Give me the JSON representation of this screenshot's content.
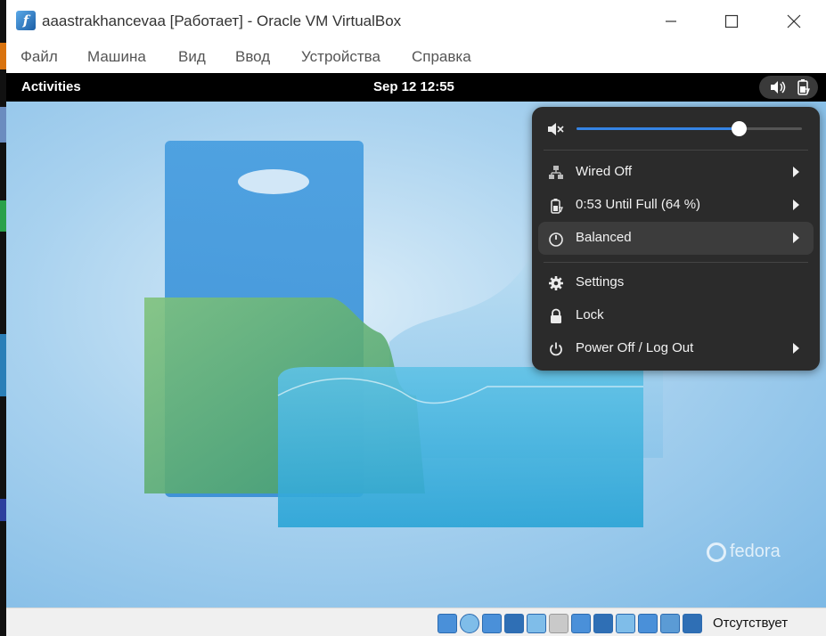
{
  "window": {
    "title": "aaastrakhancevaa [Работает] - Oracle VM VirtualBox",
    "app_icon": "virtualbox-icon"
  },
  "menu": {
    "items": [
      "Файл",
      "Машина",
      "Вид",
      "Ввод",
      "Устройства",
      "Справка"
    ]
  },
  "gnome": {
    "activities": "Activities",
    "clock": "Sep 12  12:55",
    "tray_icons": [
      "volume-icon",
      "battery-charging-icon"
    ]
  },
  "quick_settings": {
    "volume_level": 0.72,
    "items": [
      {
        "label": "Wired Off",
        "icon": "wired-network-off-icon",
        "has_arrow": true
      },
      {
        "label": "0:53 Until Full (64 %)",
        "icon": "battery-charging-icon",
        "has_arrow": true
      },
      {
        "label": "Balanced",
        "icon": "power-profile-icon",
        "has_arrow": true
      },
      {
        "label": "Settings",
        "icon": "gear-icon",
        "has_arrow": false
      },
      {
        "label": "Lock",
        "icon": "lock-icon",
        "has_arrow": false
      },
      {
        "label": "Power Off / Log Out",
        "icon": "power-icon",
        "has_arrow": true
      }
    ]
  },
  "desktop": {
    "logo_text": "fedora"
  },
  "statusbar": {
    "host_key_text": "Отсутствует",
    "icons": [
      "hard-disk-icon",
      "optical-disk-icon",
      "audio-icon",
      "network-icon",
      "usb-icon",
      "shared-folders-icon",
      "display-icon",
      "snapshot-icon",
      "recording-icon",
      "cpu-icon",
      "mouse-integration-icon",
      "host-key-icon"
    ]
  },
  "colors": {
    "accent": "#3584e4",
    "menu_bg": "#2b2b2b",
    "menu_hover": "#3c3c3c",
    "topbar": "#000000"
  }
}
